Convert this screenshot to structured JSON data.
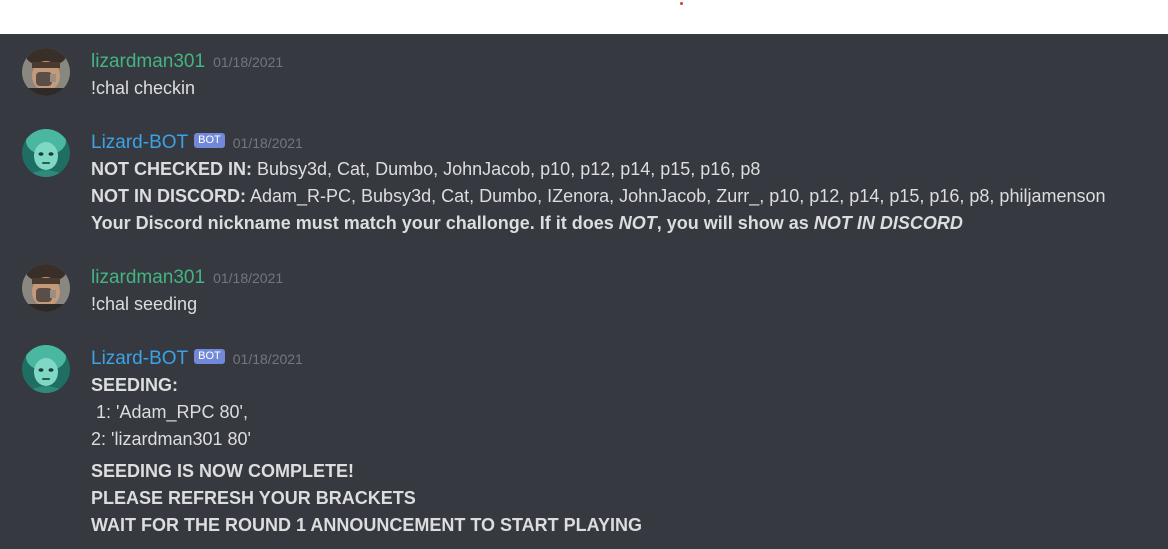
{
  "colors": {
    "background": "#36393f",
    "text": "#dcddde",
    "human_username": "#43b581",
    "bot_username": "#3ba3e8",
    "bot_badge": "#7289da",
    "timestamp": "#72767d"
  },
  "messages": [
    {
      "username": "lizardman301",
      "timestamp": "01/18/2021",
      "text": "!chal checkin"
    },
    {
      "username": "Lizard-BOT",
      "badge": "BOT",
      "timestamp": "01/18/2021",
      "not_checked_label": "NOT CHECKED IN:",
      "not_checked_list": " Bubsy3d, Cat, Dumbo, JohnJacob, p10, p12, p14, p15, p16, p8",
      "not_in_discord_label": "NOT IN DISCORD:",
      "not_in_discord_list": " Adam_R-PC, Bubsy3d, Cat, Dumbo, IZenora, JohnJacob, Zurr_, p10, p12, p14, p15, p16, p8, philjamenson",
      "notice_part1": "Your Discord nickname must match your challonge. If it does ",
      "notice_not": "NOT",
      "notice_part2": ", you will show as ",
      "notice_not_in_discord": "NOT IN DISCORD"
    },
    {
      "username": "lizardman301",
      "timestamp": "01/18/2021",
      "text": "!chal seeding"
    },
    {
      "username": "Lizard-BOT",
      "badge": "BOT",
      "timestamp": "01/18/2021",
      "seeding_label": "SEEDING:",
      "seed_1": " 1: 'Adam_RPC 80',",
      "seed_2": "2: 'lizardman301 80'",
      "complete_line": "SEEDING IS NOW COMPLETE!",
      "refresh_line": "PLEASE REFRESH YOUR BRACKETS",
      "wait_line": "WAIT FOR THE ROUND 1 ANNOUNCEMENT TO START PLAYING"
    }
  ]
}
